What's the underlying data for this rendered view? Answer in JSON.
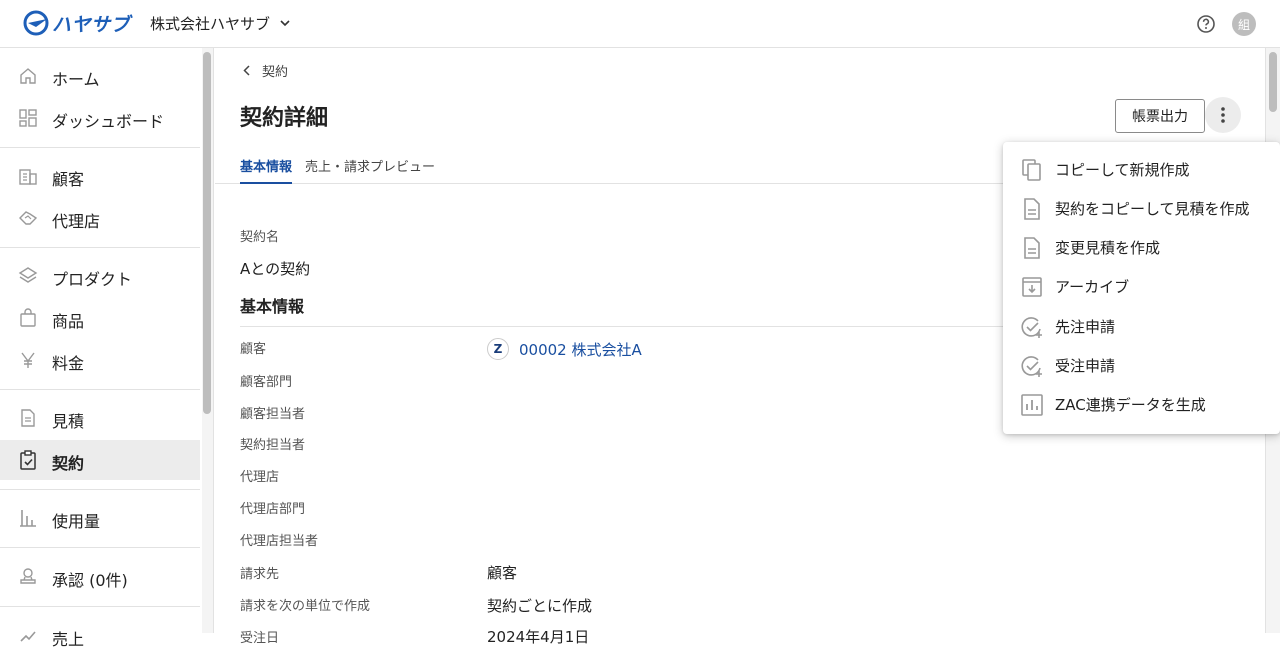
{
  "header": {
    "logo_text": "ハヤサブ",
    "company_name": "株式会社ハヤサブ",
    "avatar_initial": "組"
  },
  "sidebar": {
    "items": [
      {
        "label": "ホーム",
        "icon": "home-icon"
      },
      {
        "label": "ダッシュボード",
        "icon": "dashboard-icon"
      },
      {
        "label": "顧客",
        "icon": "building-icon"
      },
      {
        "label": "代理店",
        "icon": "handshake-icon"
      },
      {
        "label": "プロダクト",
        "icon": "layers-icon"
      },
      {
        "label": "商品",
        "icon": "bag-icon"
      },
      {
        "label": "料金",
        "icon": "yen-icon"
      },
      {
        "label": "見積",
        "icon": "document-icon"
      },
      {
        "label": "契約",
        "icon": "clipboard-check-icon",
        "active": true
      },
      {
        "label": "使用量",
        "icon": "bar-chart-icon"
      },
      {
        "label": "承認 (0件)",
        "icon": "stamp-icon"
      },
      {
        "label": "売上",
        "icon": "sales-icon"
      }
    ]
  },
  "main": {
    "breadcrumb": "契約",
    "title": "契約詳細",
    "export_button": "帳票出力",
    "tabs": [
      {
        "label": "基本情報",
        "active": true
      },
      {
        "label": "売上・請求プレビュー",
        "active": false
      }
    ],
    "contract_name_label": "契約名",
    "contract_name_value": "Aとの契約",
    "section_title": "基本情報",
    "fields": [
      {
        "label": "顧客",
        "value": ""
      },
      {
        "label": "顧客部門",
        "value": ""
      },
      {
        "label": "顧客担当者",
        "value": ""
      },
      {
        "label": "契約担当者",
        "value": ""
      },
      {
        "label": "代理店",
        "value": ""
      },
      {
        "label": "代理店部門",
        "value": ""
      },
      {
        "label": "代理店担当者",
        "value": ""
      },
      {
        "label": "請求先",
        "value": "顧客"
      },
      {
        "label": "請求を次の単位で作成",
        "value": "契約ごとに作成"
      },
      {
        "label": "受注日",
        "value": "2024年4月1日"
      }
    ],
    "customer_badge": "Z",
    "customer_link": "00002 株式会社A"
  },
  "menu": {
    "items": [
      {
        "label": "コピーして新規作成",
        "icon": "copy-icon"
      },
      {
        "label": "契約をコピーして見積を作成",
        "icon": "document-icon"
      },
      {
        "label": "変更見積を作成",
        "icon": "document-icon"
      },
      {
        "label": "アーカイブ",
        "icon": "archive-icon"
      },
      {
        "label": "先注申請",
        "icon": "check-add-icon"
      },
      {
        "label": "受注申請",
        "icon": "check-add-icon"
      },
      {
        "label": "ZAC連携データを生成",
        "icon": "bar-chart-box-icon"
      }
    ]
  },
  "colors": {
    "brand": "#1e5fb8",
    "link": "#1a4fa0",
    "active_bg": "#ececec"
  }
}
